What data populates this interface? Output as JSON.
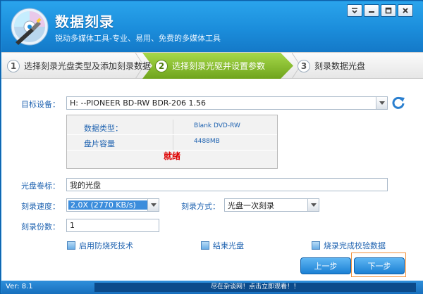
{
  "app": {
    "title": "数据刻录",
    "subtitle": "锐动多媒体工具-专业、易用、免费的多媒体工具"
  },
  "window_controls": [
    "menu-icon",
    "minimize-icon",
    "maximize-icon",
    "close-icon"
  ],
  "steps": [
    {
      "number": "1",
      "label": "选择刻录光盘类型及添加刻录数据",
      "active": false
    },
    {
      "number": "2",
      "label": "选择刻录光驱并设置参数",
      "active": true
    },
    {
      "number": "3",
      "label": "刻录数据光盘",
      "active": false
    }
  ],
  "form": {
    "target_device_label": "目标设备：",
    "target_device_value": "H:  --PIONEER BD-RW   BDR-206  1.56",
    "info": {
      "disc_type_label": "数据类型：",
      "disc_type_value": "Blank DVD-RW",
      "capacity_label": "盘片容量",
      "capacity_value": "4488MB",
      "status": "就绪"
    },
    "volume_label": "光盘卷标：",
    "volume_value": "我的光盘",
    "speed_label": "刻录速度：",
    "speed_value": "2.0X   (2770 KB/s)",
    "mode_label": "刻录方式：",
    "mode_value": "光盘一次刻录",
    "copies_label": "刻录份数：",
    "copies_value": "1",
    "options": [
      {
        "label": "启用防烧死技术",
        "checked": true
      },
      {
        "label": "结束光盘",
        "checked": true
      },
      {
        "label": "烧录完成校验数据",
        "checked": true
      }
    ]
  },
  "buttons": {
    "prev": "上一步",
    "next": "下一步"
  },
  "statusbar": {
    "version": "Ver: 8.1",
    "ad": "尽在杂谈网！点击立即观看！！"
  },
  "colors": {
    "header_blue": "#1b8ddb",
    "active_step_green": "#7cb224",
    "label_blue": "#1e62b0",
    "status_red": "#dd0000",
    "next_focus_orange": "#f2913b"
  }
}
